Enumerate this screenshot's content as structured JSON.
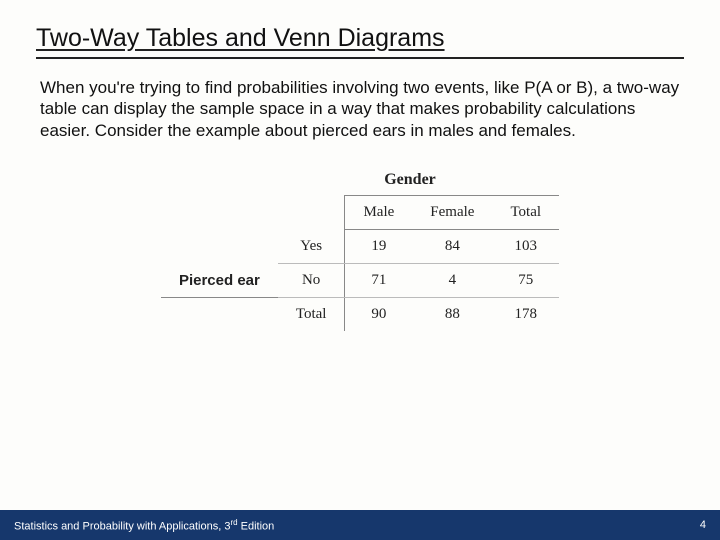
{
  "title": "Two-Way Tables and Venn Diagrams",
  "paragraph": "When you're trying to find probabilities involving two events, like P(A or B), a two-way table can display the sample space in a way that makes probability calculations easier. Consider the example about pierced ears in males and females.",
  "table": {
    "col_group_label": "Gender",
    "row_group_label": "Pierced ear",
    "col_headers": [
      "Male",
      "Female",
      "Total"
    ],
    "row_headers": [
      "Yes",
      "No",
      "Total"
    ],
    "cells": {
      "yes_male": "19",
      "yes_female": "84",
      "yes_total": "103",
      "no_male": "71",
      "no_female": "4",
      "no_total": "75",
      "tot_male": "90",
      "tot_female": "88",
      "tot_total": "178"
    }
  },
  "footer": {
    "text_prefix": "Statistics and Probability with Applications, 3",
    "text_sup": "rd",
    "text_suffix": " Edition",
    "page": "4"
  },
  "chart_data": {
    "type": "table",
    "title": "Pierced ear by Gender",
    "row_variable": "Pierced ear",
    "col_variable": "Gender",
    "categories_rows": [
      "Yes",
      "No"
    ],
    "categories_cols": [
      "Male",
      "Female"
    ],
    "values": [
      [
        19,
        84
      ],
      [
        71,
        4
      ]
    ],
    "row_totals": [
      103,
      75
    ],
    "col_totals": [
      90,
      88
    ],
    "grand_total": 178
  }
}
